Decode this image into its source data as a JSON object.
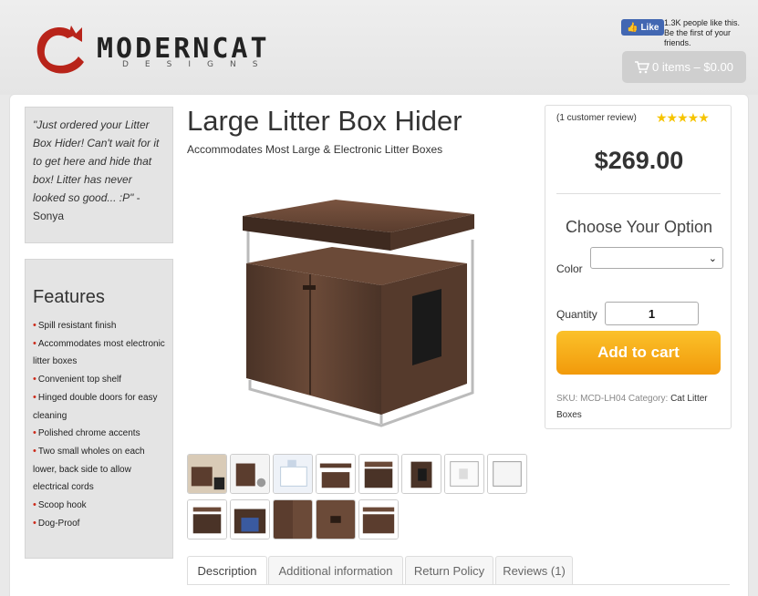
{
  "header": {
    "brand_name": "MODERNCAT",
    "brand_sub": "DESIGNS",
    "fb_like_label": "Like",
    "fb_like_text": "1.3K people like this. Be the first of your friends.",
    "cart_label": "0 items – $0.00"
  },
  "testimonial": {
    "quote": "\"Just ordered your Litter Box Hider! Can't wait for it to get here and hide that box! Litter has never looked so good... :P\"",
    "author": " - Sonya"
  },
  "features": {
    "title": "Features",
    "items": [
      "Spill resistant finish",
      "Accommodates most electronic litter boxes",
      "Convenient top shelf",
      "Hinged double doors for easy cleaning",
      "Polished chrome accents",
      "Two small wholes on each lower, back side to allow electrical cords",
      "Scoop hook",
      "Dog-Proof"
    ]
  },
  "product": {
    "title": "Large Litter Box Hider",
    "subtitle": "Accommodates Most Large & Electronic Litter Boxes",
    "review_count": "(1 customer review)",
    "rating_stars": "★★★★★",
    "price": "$269.00",
    "choose_option": "Choose Your Option",
    "color_label": "Color",
    "quantity_label": "Quantity",
    "quantity_value": "1",
    "add_to_cart": "Add to cart",
    "sku_label": "SKU:",
    "sku_value": "MCD-LH04",
    "category_label": "Category:",
    "category_value": "Cat Litter Boxes"
  },
  "tabs": [
    "Description",
    "Additional information",
    "Return Policy",
    "Reviews (1)"
  ]
}
